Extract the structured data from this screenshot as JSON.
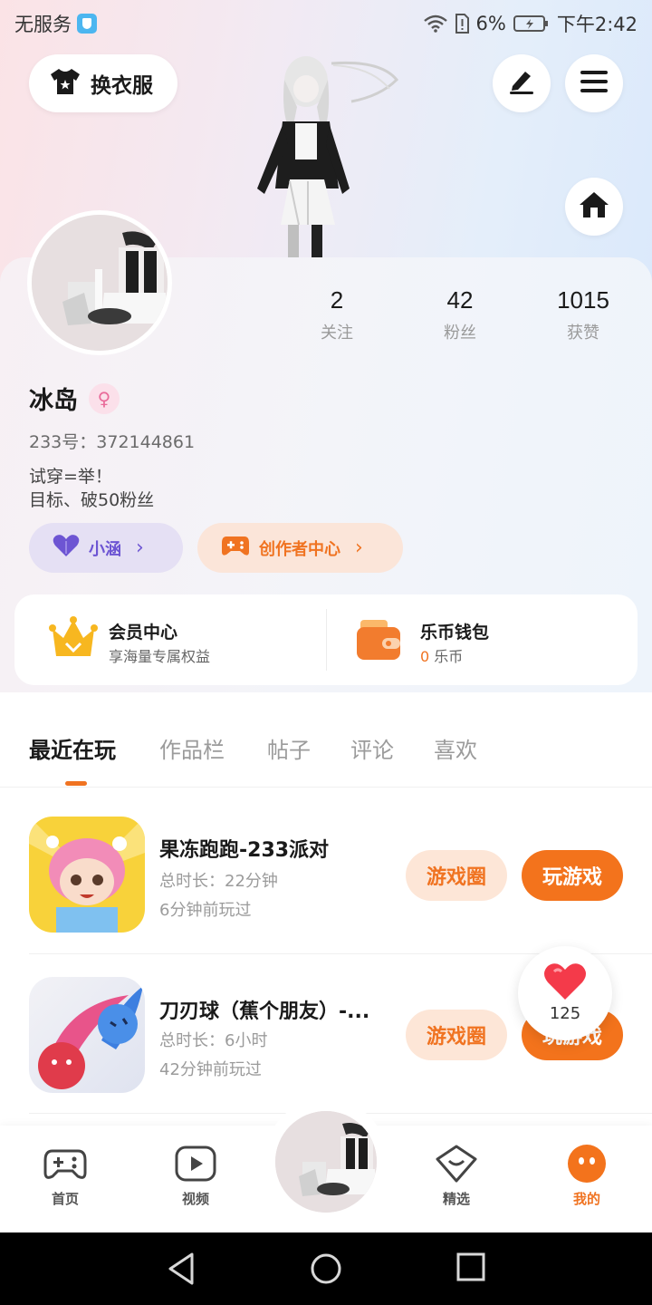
{
  "status_bar": {
    "carrier": "无服务",
    "battery": "6%",
    "time": "下午2:42"
  },
  "header": {
    "outfit_button": "换衣服"
  },
  "profile": {
    "stats": [
      {
        "value": "2",
        "label": "关注"
      },
      {
        "value": "42",
        "label": "粉丝"
      },
      {
        "value": "1015",
        "label": "获赞"
      }
    ],
    "name": "冰岛",
    "gender_symbol": "♀",
    "uid": "233号：372144861",
    "bio_lines": [
      "试穿=举！",
      "目标、破50粉丝"
    ],
    "pills": [
      {
        "label": "小涵",
        "chevron": "›"
      },
      {
        "label": "创作者中心",
        "chevron": "›"
      }
    ]
  },
  "member": {
    "title": "会员中心",
    "subtitle": "享海量专属权益"
  },
  "wallet": {
    "title": "乐币钱包",
    "amount": "0",
    "unit": " 乐币"
  },
  "tabs": [
    "最近在玩",
    "作品栏",
    "帖子",
    "评论",
    "喜欢"
  ],
  "games": [
    {
      "name": "果冻跑跑-233派对",
      "duration": "总时长：22分钟",
      "last_played": "6分钟前玩过",
      "circle_button": "游戏圈",
      "play_button": "玩游戏"
    },
    {
      "name": "刀刃球（蕉个朋友）-...",
      "duration": "总时长：6小时",
      "last_played": "42分钟前玩过",
      "circle_button": "游戏圈",
      "play_button": "玩游戏"
    }
  ],
  "like_bubble": {
    "count": "125"
  },
  "bottom_nav": [
    {
      "label": "首页",
      "icon": "gamepad-icon"
    },
    {
      "label": "视频",
      "icon": "video-play-icon"
    },
    {
      "label": "精选",
      "icon": "heart-chat-icon"
    },
    {
      "label": "我的",
      "icon": "profile-face-icon"
    }
  ],
  "colors": {
    "accent": "#f3731c",
    "purple": "#6d55d3",
    "pink": "#e96b9a"
  }
}
